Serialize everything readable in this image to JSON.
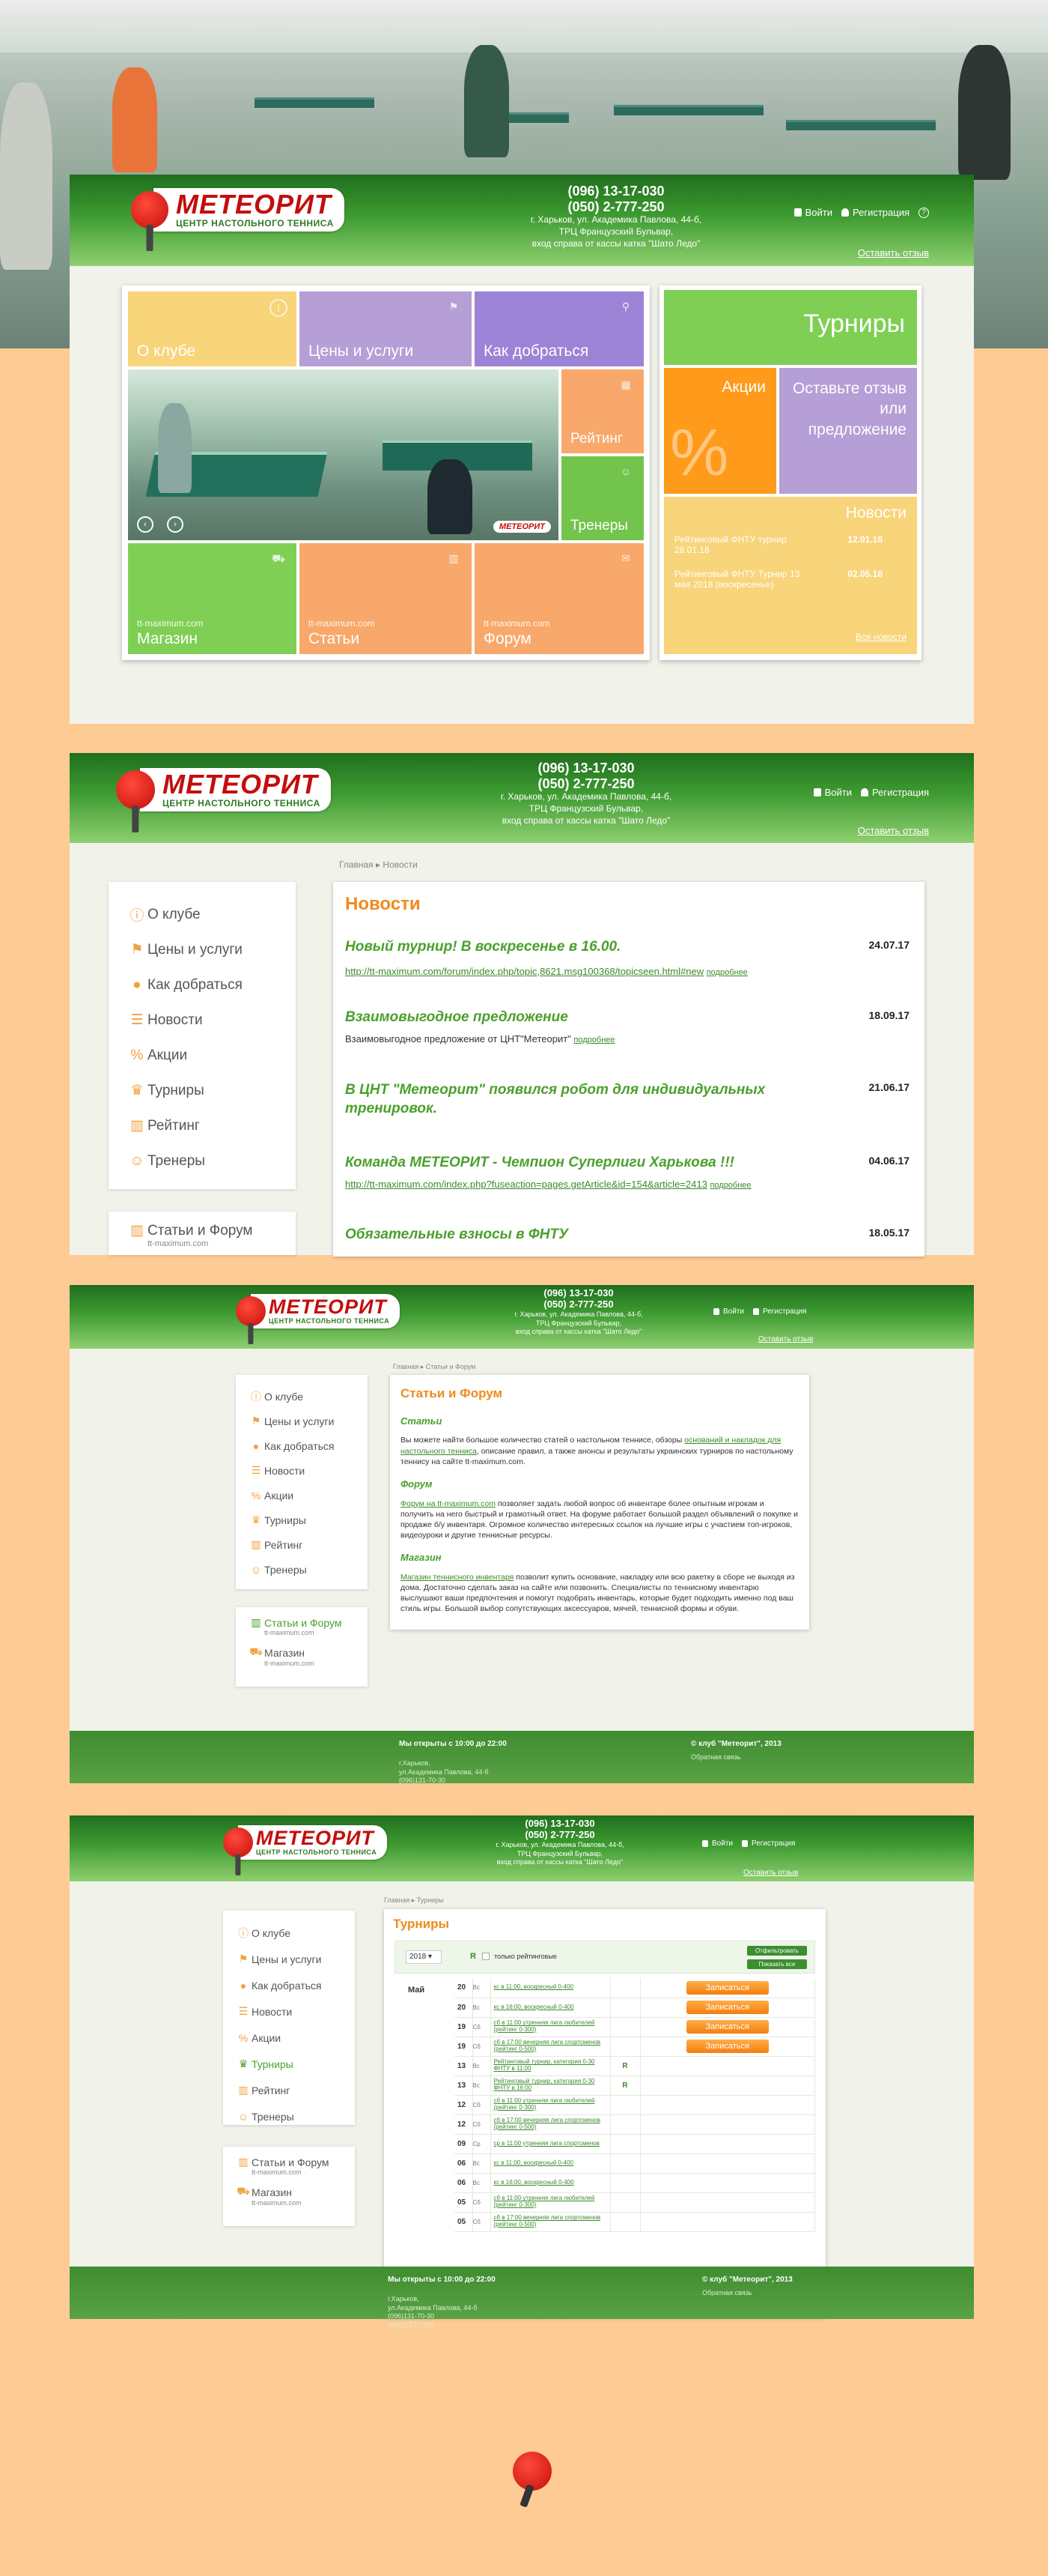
{
  "site": {
    "logo_title": "МЕТЕОРИТ",
    "logo_subtitle": "ЦЕНТР НАСТОЛЬНОГО ТЕННИСА",
    "phone1": "(096) 13-17-030",
    "phone2": "(050) 2-777-250",
    "addr1": "г. Харьков, ул. Академика Павлова, 44-б,",
    "addr2": "ТРЦ Французский Бульвар,",
    "addr3": "вход справа от кассы катка \"Шато Ледо\"",
    "login": "Войти",
    "register": "Регистрация",
    "help": "?",
    "feedback": "Оставить отзыв"
  },
  "home": {
    "tiles": {
      "about": "О клубе",
      "prices": "Цены и услуги",
      "howto": "Как добраться",
      "rating": "Рейтинг",
      "trainers": "Тренеры",
      "shop": "Магазин",
      "articles": "Статьи",
      "forum": "Форум",
      "shop_sub": "tt-maximum.com",
      "articles_sub": "tt-maximum.com",
      "forum_sub": "tt-maximum.com",
      "photo_badge": "МЕТЕОРИТ"
    },
    "right": {
      "tournaments": "Турниры",
      "actions": "Акции",
      "review": "Оставьте отзыв или предложение",
      "percent": "%",
      "news": "Новости",
      "n1_text": "Рейтинговый ФНТУ турнир 28.01.18",
      "n1_date": "12.01.18",
      "n2_text": "Рейтинговый ФНТУ Турнир 13 мая 2018 (воскресенье)",
      "n2_date": "02.05.18",
      "all_news": "Вся новости"
    }
  },
  "menu": {
    "about": "О клубе",
    "prices": "Цены и услуги",
    "howto": "Как добраться",
    "news": "Новости",
    "actions": "Акции",
    "tournaments": "Турниры",
    "rating": "Рейтинг",
    "trainers": "Тренеры",
    "articles_forum": "Статьи и Форум",
    "shop": "Магазин",
    "site": "tt-maximum.com"
  },
  "news_page": {
    "crumb_home": "Главная",
    "crumb_sep": "▸",
    "crumb_cur": "Новости",
    "title": "Новости",
    "items": [
      {
        "title": "Новый турнир! В воскресенье в 16.00.",
        "date": "24.07.17",
        "text": "http://tt-maximum.com/forum/index.php/topic,8621.msg100368/topicseen.html#new",
        "more": "подробнее"
      },
      {
        "title": "Взаимовыгодное предложение",
        "date": "18.09.17",
        "text": "Взаимовыгодное предложение от ЦНТ\"Метеорит\"",
        "more": "подробнее"
      },
      {
        "title": "В ЦНТ \"Метеорит\" появился робот для индивидуальных тренировок.",
        "date": "21.06.17",
        "text": "",
        "more": ""
      },
      {
        "title": "Команда МЕТЕОРИТ - Чемпион Суперлиги Харькова !!!",
        "date": "04.06.17",
        "text": "http://tt-maximum.com/index.php?fuseaction=pages.getArticle&id=154&article=2413",
        "more": "подробнее"
      },
      {
        "title": "Обязательные взносы в ФНТУ",
        "date": "18.05.17",
        "text": "",
        "more": ""
      }
    ]
  },
  "articles_page": {
    "crumb_home": "Главная",
    "crumb_cur": "Статьи и Форум",
    "title": "Статьи и Форум",
    "s1": "Статьи",
    "p1a": "Вы можете найти большое количество статей о настольном теннисе, обзоры",
    "p1link": "оснований и накладок для настольного тенниса",
    "p1b": ", описание правил, а также анонсы и результаты украинских турниров по настольному теннису на сайте tt-maximum.com.",
    "s2": "Форум",
    "p2link": "Форум на tt-maximum.com",
    "p2": "позволяет задать любой вопрос об инвентаре более опытным игрокам и получить на него быстрый и грамотный ответ. На форуме работает большой раздел объявлений о покупке и продаже б/у инвентаря. Огромное количество интересных ссылок на лучшие игры с участием топ-игроков, видеоуроки и другие теннисные ресурсы.",
    "s3": "Магазин",
    "p3link": "Магазин теннисного инвентаря",
    "p3": "позволит купить основание, накладку или всю ракетку в сборе не выходя из дома. Достаточно сделать заказ на сайте или позвонить. Специалисты по теннисному инвентарю выслушают ваши предпочтения и помогут подобрать инвентарь, которые будет подходить именно под ваш стиль игры. Большой выбор сопутствующих аксессуаров, мячей, теннисной формы и обуви."
  },
  "footer": {
    "open": "Мы открыты с 10:00 до 22:00",
    "copy": "© клуб \"Метеорит\", 2013",
    "city": "г.Харьков,",
    "street": "ул.Академика Павлова, 44-б",
    "ph1": "(096)131-70-30",
    "ph2": "(050)2-777-250",
    "feedback": "Обратная связь"
  },
  "tour_page": {
    "crumb_home": "Главная",
    "crumb_cur": "Турниры",
    "title": "Турниры",
    "year": "2018",
    "rated_mark": "R",
    "rated_only": "только рейтинговые",
    "btn_filter": "Отфильтровать",
    "btn_all": "Показать все",
    "month": "Май",
    "signup": "Записаться",
    "rows": [
      {
        "d": "20",
        "w": "Вс",
        "t": "кс в 11:00, воскресный 0-400",
        "r": "",
        "s": true
      },
      {
        "d": "20",
        "w": "Вс",
        "t": "кс в 16:00, воскресный 0-400",
        "r": "",
        "s": true
      },
      {
        "d": "19",
        "w": "Сб",
        "t": "сб в 11:00 утренняя лига любителей (рейтинг 0-300)",
        "r": "",
        "s": true
      },
      {
        "d": "19",
        "w": "Сб",
        "t": "сб в 17:00 вечерняя лига спортсменов (рейтинг 0-500)",
        "r": "",
        "s": true
      },
      {
        "d": "13",
        "w": "Вс",
        "t": "Рейтинговый турнир, категория 0-30 ФНТУ в 11:00",
        "r": "R",
        "s": false
      },
      {
        "d": "13",
        "w": "Вс",
        "t": "Рейтинговый турнир, категория 0-30 ФНТУ в 16:00",
        "r": "R",
        "s": false
      },
      {
        "d": "12",
        "w": "Сб",
        "t": "сб в 11:00 утренняя лига любителей (рейтинг 0-300)",
        "r": "",
        "s": false
      },
      {
        "d": "12",
        "w": "Сб",
        "t": "сб в 17:00 вечерняя лига спортсменов (рейтинг 0-500)",
        "r": "",
        "s": false
      },
      {
        "d": "09",
        "w": "Ср",
        "t": "ср в 11:00 утренняя лига спортсменов",
        "r": "",
        "s": false
      },
      {
        "d": "06",
        "w": "Вс",
        "t": "кс в 11:00, воскресный 0-400",
        "r": "",
        "s": false
      },
      {
        "d": "06",
        "w": "Вс",
        "t": "кс в 16:00, воскресный 0-400",
        "r": "",
        "s": false
      },
      {
        "d": "05",
        "w": "Сб",
        "t": "сб в 11:00 утренняя лига любителей (рейтинг 0-300)",
        "r": "",
        "s": false
      },
      {
        "d": "05",
        "w": "Сб",
        "t": "сб в 17:00 вечерняя лига спортсменов (рейтинг 0-500)",
        "r": "",
        "s": false
      }
    ]
  }
}
